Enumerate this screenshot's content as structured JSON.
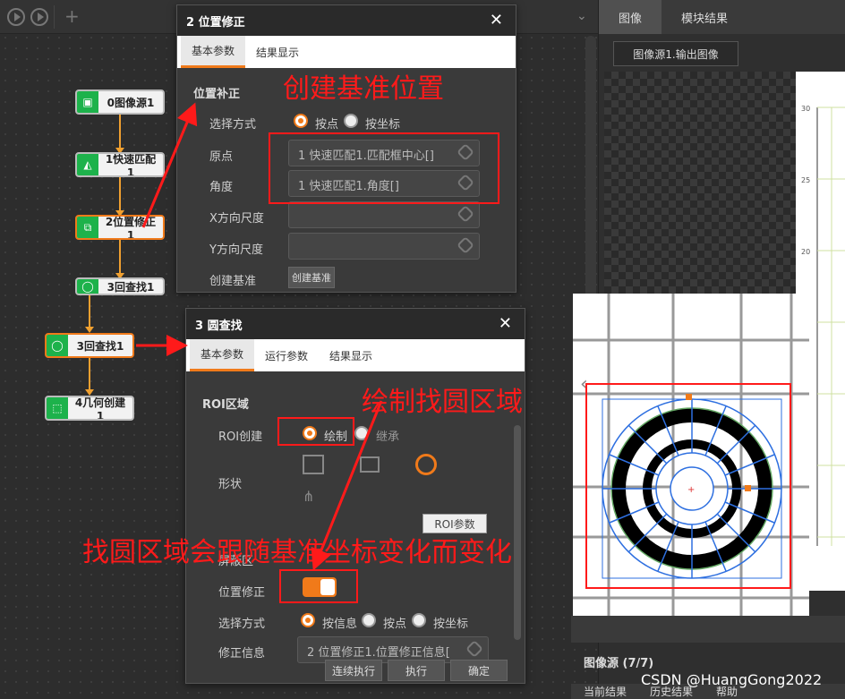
{
  "flow": {
    "nodes": [
      {
        "label": "0图像源1"
      },
      {
        "label": "1快速匹配1"
      },
      {
        "label": "2位置修正1"
      },
      {
        "label": "3回查找1"
      },
      {
        "label": "3回查找1"
      },
      {
        "label": "4几何创建1"
      }
    ]
  },
  "dialog1": {
    "title": "2 位置修正",
    "close": "✕",
    "tabs": [
      "基本参数",
      "结果显示"
    ],
    "section": "位置补正",
    "select_method_label": "选择方式",
    "method_options": [
      "按点",
      "按坐标"
    ],
    "origin_label": "原点",
    "origin_value": "1 快速匹配1.匹配框中心[]",
    "angle_label": "角度",
    "angle_value": "1 快速匹配1.角度[]",
    "x_scale_label": "X方向尺度",
    "y_scale_label": "Y方向尺度",
    "create_ref_label": "创建基准",
    "create_ref_button": "创建基准"
  },
  "dialog2": {
    "title": "3 圆查找",
    "close": "✕",
    "tabs": [
      "基本参数",
      "运行参数",
      "结果显示"
    ],
    "section": "ROI区域",
    "roi_create_label": "ROI创建",
    "roi_options": [
      "绘制",
      "继承"
    ],
    "shape_label": "形状",
    "roi_params": "ROI参数",
    "mask_label": "屏蔽区",
    "pos_fix_label": "位置修正",
    "select_method_label": "选择方式",
    "method_options": [
      "按信息",
      "按点",
      "按坐标"
    ],
    "fix_info_label": "修正信息",
    "fix_info_value": "2 位置修正1.位置修正信息[",
    "buttons": [
      "连续执行",
      "执行",
      "确定"
    ]
  },
  "right": {
    "tabs": [
      "图像",
      "模块结果"
    ],
    "source_select": "图像源1.输出图像",
    "y_ticks": [
      "30",
      "25",
      "20"
    ],
    "image_source": "图像源 (7/7)",
    "bottom_tabs": [
      "当前结果",
      "历史结果",
      "帮助"
    ]
  },
  "annotations": {
    "create_ref": "创建基准位置",
    "draw_roi": "绘制找圆区域",
    "follow": "找圆区域会跟随基准坐标变化而变化"
  },
  "watermark": "CSDN @HuangGong2022",
  "colors": {
    "accent": "#f07a1a",
    "node_icon": "#1db24b",
    "annotation": "#ff1a1a",
    "overlay": "#2d6fe0"
  },
  "state": {
    "pos_fix_toggle": "on",
    "dialog1_method": "按点",
    "dialog2_roi": "绘制",
    "dialog2_method": "按信息"
  }
}
